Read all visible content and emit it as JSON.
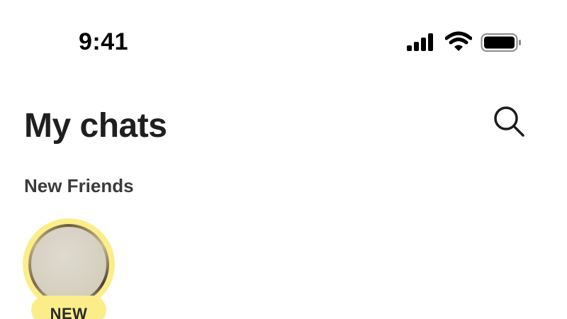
{
  "status_bar": {
    "time": "9:41",
    "icons": [
      "cellular-signal-icon",
      "wifi-icon",
      "battery-icon"
    ]
  },
  "header": {
    "title": "My chats",
    "search_icon": "search-icon"
  },
  "new_friends": {
    "label": "New Friends",
    "items": [
      {
        "badge": "NEW"
      }
    ]
  },
  "colors": {
    "background": "#ffffff",
    "title_text": "#1f1f1f",
    "section_text": "#3b3b3b",
    "new_highlight": "#fbee8a"
  }
}
